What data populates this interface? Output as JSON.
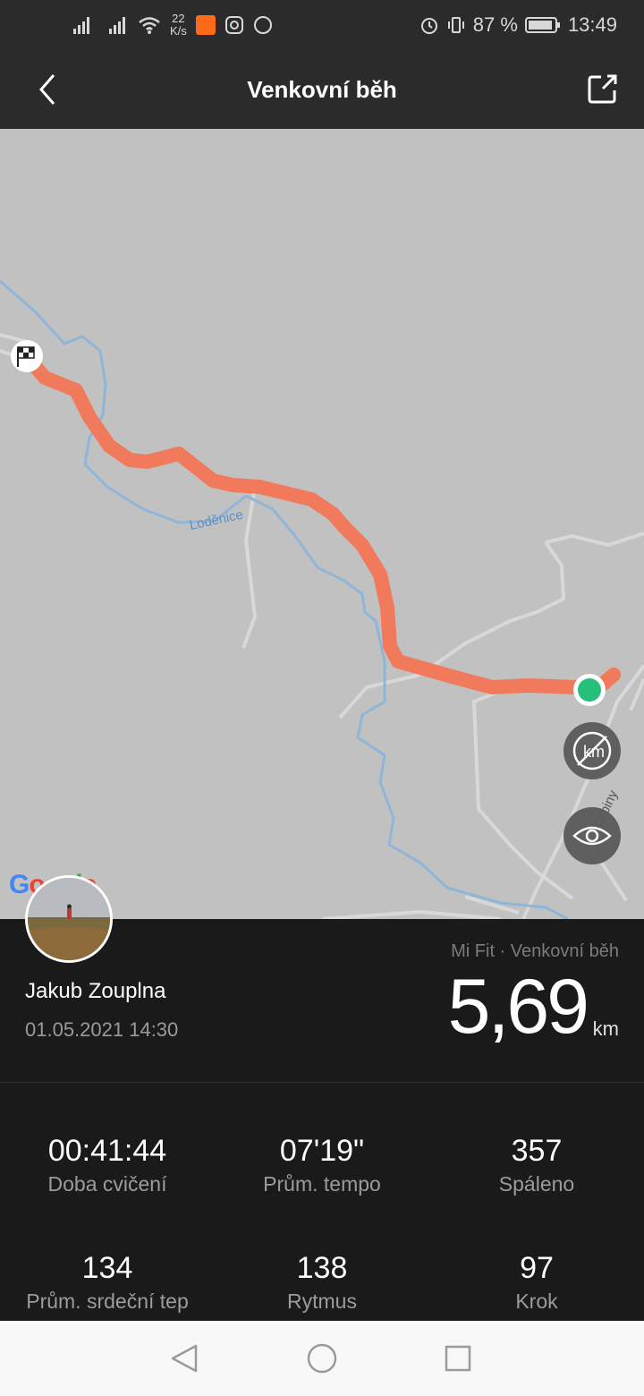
{
  "status_bar": {
    "net_speed_value": "22",
    "net_speed_unit": "K/s",
    "battery": "87 %",
    "time": "13:49"
  },
  "header": {
    "title": "Venkovní běh"
  },
  "map": {
    "river_label": "Loděnice",
    "street_label": "Orbiny",
    "route_color": "#f27a5c",
    "start_marker_color": "#26c07a",
    "attribution": "Google"
  },
  "activity": {
    "user_name": "Jakub Zouplna",
    "datetime": "01.05.2021 14:30",
    "source": "Mi Fit · Venkovní běh",
    "distance": "5,69",
    "distance_unit": "km"
  },
  "stats": [
    {
      "value": "00:41:44",
      "label": "Doba cvičení"
    },
    {
      "value": "07'19\"",
      "label": "Prům. tempo"
    },
    {
      "value": "357",
      "label": "Spáleno"
    },
    {
      "value": "134",
      "label": "Prům. srdeční tep"
    },
    {
      "value": "138",
      "label": "Rytmus"
    },
    {
      "value": "97",
      "label": "Krok"
    }
  ]
}
